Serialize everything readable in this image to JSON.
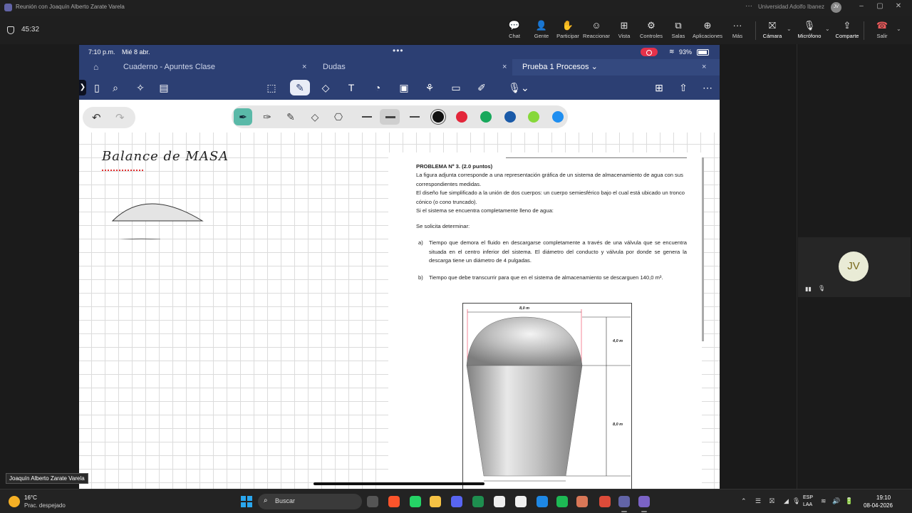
{
  "window": {
    "title": "Reunión con Joaquín Alberto Zarate Varela",
    "organization": "Universidad Adolfo Ibanez",
    "org_avatar": "JV",
    "more": "···",
    "minimize": "–",
    "maximize": "▢",
    "close": "✕"
  },
  "meeting": {
    "timer": "45:32",
    "buttons": [
      {
        "label": "Chat",
        "icon": "chat-icon",
        "glyph": "💬"
      },
      {
        "label": "Gente",
        "icon": "people-icon",
        "glyph": "👤"
      },
      {
        "label": "Participar",
        "icon": "raise-hand-icon",
        "glyph": "✋"
      },
      {
        "label": "Reaccionar",
        "icon": "smiley-icon",
        "glyph": "☺"
      },
      {
        "label": "Vista",
        "icon": "grid-icon",
        "glyph": "⊞"
      },
      {
        "label": "Controles",
        "icon": "controls-icon",
        "glyph": "⚙"
      },
      {
        "label": "Salas",
        "icon": "rooms-icon",
        "glyph": "⧉"
      },
      {
        "label": "Aplicaciones",
        "icon": "apps-icon",
        "glyph": "⊕"
      },
      {
        "label": "Más",
        "icon": "more-icon",
        "glyph": "···"
      }
    ],
    "camera_label": "Cámara",
    "camera_glyph": "⛝",
    "mic_label": "Micrófono",
    "mic_glyph": "🎙",
    "share_label": "Comparte",
    "share_glyph": "⇪",
    "leave_label": "Salir",
    "leave_glyph": "☎"
  },
  "participant": {
    "initials": "JV",
    "signal_glyph": "▮▮",
    "mic_glyph": "🎙",
    "presenter_name": "Joaquín Alberto Zarate Varela"
  },
  "ipad": {
    "time": "7:10 p.m.",
    "date": "Mié 8 abr.",
    "dots": "•••",
    "wifi_glyph": "≋",
    "battery": "93%",
    "tabs": [
      {
        "label": "Cuaderno - Apuntes Clase",
        "close": "×"
      },
      {
        "label": "Dudas",
        "close": "×"
      },
      {
        "label": "Prueba 1 Procesos ⌄",
        "close": "×"
      }
    ],
    "home_glyph": "⌂",
    "sidebar_glyph": "❯"
  },
  "toolbar_glyphs": {
    "sidebar": "▯",
    "search": "⌕",
    "magic": "✧",
    "pages": "▤",
    "lasso": "⬚",
    "pen": "✎",
    "eraser": "◇",
    "text": "T",
    "shapes": "◔",
    "image": "▣",
    "stickers": "⚘",
    "note": "▭",
    "highlighter": "✐",
    "mic": "🎙⌄",
    "add_page": "⊞",
    "share": "⇧",
    "more": "⋯"
  },
  "pen_bar": {
    "undo": "↶",
    "redo": "↷",
    "tools": [
      "✒",
      "✑",
      "✎",
      "◇",
      "⎔"
    ],
    "colors": [
      "#111111",
      "#e3263a",
      "#18a85c",
      "#1a5aa8",
      "#86d83a",
      "#1f8ef0"
    ]
  },
  "handwriting": {
    "title": "Balance de MASA"
  },
  "problem": {
    "title": "PROBLEMA Nº 3. (2.0 puntos)",
    "p1": "La figura adjunta corresponde a una representación gráfica de un sistema de almacenamiento de agua con sus correspondientes medidas.",
    "p2": "El diseño fue simplificado a la unión de dos cuerpos: un cuerpo semiesférico bajo el cual está ubicado un tronco cónico (o cono truncado).",
    "p3": "Si el sistema se encuentra completamente lleno de agua:",
    "p4": "Se solicita determinar:",
    "a_label": "a)",
    "a_text": "Tiempo que demora el fluido en descargarse completamente a través de una válvula  que se encuentra situada en el centro inferior del sistema. El diámetro del conducto y válvula por donde se genera la descarga tiene un diámetro de 4 pulgadas.",
    "b_label": "b)",
    "b_text": "Tiempo que debe transcurrir para que en el sistema de almacenamiento se descarguen 140,0 m³.",
    "dim_top": "8,0 m",
    "dim_dome": "4,0 m",
    "dim_cone": "8,0 m"
  },
  "taskbar": {
    "temp": "16°C",
    "condition": "Prac. despejado",
    "search": "Buscar",
    "search_glyph": "⌕",
    "lang1": "ESP",
    "lang2": "LAA",
    "time": "19:10",
    "date": "08-04-2026",
    "tray_glyphs": [
      "⌃",
      "☰",
      "⛝",
      "◢",
      "🎙",
      "≋",
      "🔊",
      "🔋"
    ],
    "apps": [
      {
        "name": "task-view-app",
        "color": "#555555"
      },
      {
        "name": "brave-app",
        "color": "#fb542b"
      },
      {
        "name": "whatsapp-app",
        "color": "#25d366"
      },
      {
        "name": "explorer-app",
        "color": "#f6c244"
      },
      {
        "name": "discord-app",
        "color": "#5865f2"
      },
      {
        "name": "excel-app",
        "color": "#1e8e4f"
      },
      {
        "name": "notion-app",
        "color": "#eeeeee"
      },
      {
        "name": "calendar-app",
        "color": "#f0f0f0"
      },
      {
        "name": "vpn-app",
        "color": "#1e88e5"
      },
      {
        "name": "spotify-app",
        "color": "#1db954"
      },
      {
        "name": "claude-app",
        "color": "#d97757"
      },
      {
        "name": "chrome-app",
        "color": "#dd4b39"
      },
      {
        "name": "teams-app",
        "color": "#6264a7"
      },
      {
        "name": "teams-meeting-app",
        "color": "#7b63c6"
      }
    ]
  }
}
